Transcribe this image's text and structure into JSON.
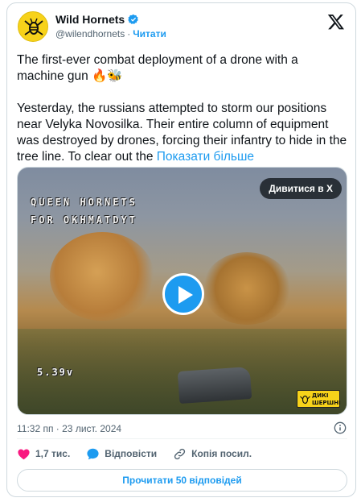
{
  "author": {
    "name": "Wild Hornets",
    "handle": "@wilendhornets",
    "separator": "·",
    "follow_label": "Читати"
  },
  "tweet": {
    "paragraph1": "The first-ever combat deployment of a drone with a machine gun 🔥🐝",
    "paragraph2": "Yesterday, the russians attempted to storm our positions near Velyka Novosilka. Their entire column of equipment was destroyed by drones, forcing their infantry to hide in the tree line. To clear out the",
    "show_more": "Показати більше"
  },
  "media": {
    "watch_label": "Дивитися в X",
    "osd_line1": "QUEEN HORNETS",
    "osd_line2": "FOR OKHMATDYT",
    "osd_voltage": "5.39v",
    "badge_line1": "ДИКІ",
    "badge_line2": "ШЕРШНІ"
  },
  "timestamp": "11:32 пп · 23 лист. 2024",
  "actions": {
    "likes": "1,7 тис.",
    "reply_label": "Відповісти",
    "copy_label": "Копія посил."
  },
  "read_replies_label": "Прочитати 50 відповідей",
  "colors": {
    "accent": "#1d9bf0",
    "like": "#f91880",
    "brand_yellow": "#f7d21a"
  },
  "icons": [
    "verified-badge-icon",
    "x-logo-icon",
    "play-icon",
    "info-icon",
    "heart-icon",
    "reply-icon",
    "link-icon",
    "hornet-logo-icon"
  ]
}
